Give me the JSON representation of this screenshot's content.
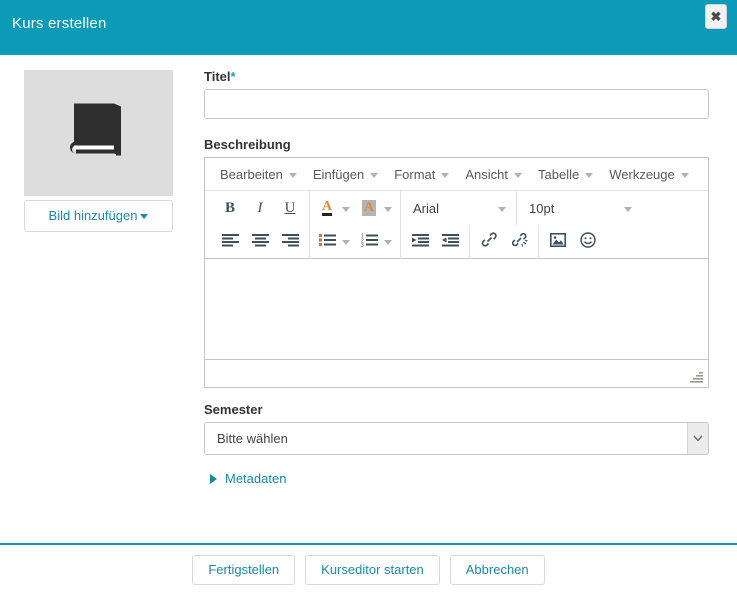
{
  "dialog": {
    "title": "Kurs erstellen",
    "close_icon": "close-icon",
    "close_label": "✖"
  },
  "image_panel": {
    "placeholder_icon": "book-icon",
    "add_image_label": "Bild hinzufügen"
  },
  "form": {
    "title_field": {
      "label": "Titel",
      "required_marker": "*",
      "value": "",
      "placeholder": ""
    },
    "description_field": {
      "label": "Beschreibung",
      "content": ""
    },
    "semester_field": {
      "label": "Semester",
      "selected": "Bitte wählen",
      "options": [
        "Bitte wählen"
      ]
    },
    "metadata_toggle": {
      "label": "Metadaten",
      "expanded": false
    }
  },
  "editor": {
    "menubar": [
      {
        "label": "Bearbeiten",
        "name": "menu-edit"
      },
      {
        "label": "Einfügen",
        "name": "menu-insert"
      },
      {
        "label": "Format",
        "name": "menu-format"
      },
      {
        "label": "Ansicht",
        "name": "menu-view"
      },
      {
        "label": "Tabelle",
        "name": "menu-table"
      },
      {
        "label": "Werkzeuge",
        "name": "menu-tools"
      }
    ],
    "toolbar_row1": {
      "bold": "B",
      "italic": "I",
      "underline": "U",
      "forecolor": "A",
      "backcolor": "A",
      "fontselect": "Arial",
      "fontsizeselect": "10pt"
    },
    "toolbar_row2": {
      "align_left": "align-left-icon",
      "align_center": "align-center-icon",
      "align_right": "align-right-icon",
      "bullist": "bullet-list-icon",
      "numlist": "numbered-list-icon",
      "outdent": "outdent-icon",
      "indent": "indent-icon",
      "link": "link-icon",
      "unlink": "unlink-icon",
      "image": "image-icon",
      "emoticon": "emoticon-icon"
    },
    "statusbar": {
      "resize_handle": "resize-grip-icon"
    }
  },
  "footer": {
    "buttons": [
      {
        "label": "Fertigstellen",
        "name": "finish-button"
      },
      {
        "label": "Kurseditor starten",
        "name": "start-course-editor-button"
      },
      {
        "label": "Abbrechen",
        "name": "cancel-button"
      }
    ]
  },
  "colors": {
    "brand_teal": "#0b9ab8",
    "link_teal": "#1b87a5",
    "placeholder_gray": "#dddddd"
  }
}
